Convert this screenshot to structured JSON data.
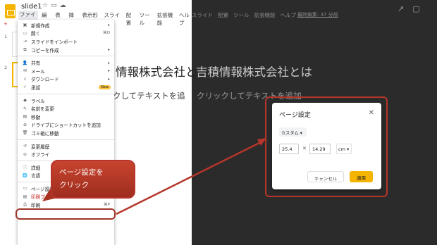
{
  "app": {
    "doc_title": "slide1",
    "menu": [
      "ファイル",
      "編集",
      "表示",
      "挿入",
      "表示形式",
      "スライド",
      "配置",
      "ツール",
      "拡張機能",
      "ヘルプ"
    ],
    "active_menu_index": 0,
    "filmstrip": [
      "1",
      "2"
    ],
    "last_edit": "最終編集: 37 分前"
  },
  "file_menu": {
    "items": [
      {
        "label": "新規作成",
        "icon": "new-icon",
        "arrow": "▸"
      },
      {
        "label": "開く",
        "icon": "open-icon",
        "shortcut": "⌘O"
      },
      {
        "label": "スライドをインポート",
        "icon": "import-icon"
      },
      {
        "label": "コピーを作成",
        "icon": "copy-icon",
        "arrow": "▸"
      },
      {
        "sep": true
      },
      {
        "label": "共有",
        "icon": "share-icon",
        "arrow": "▸"
      },
      {
        "label": "メール",
        "icon": "mail-icon",
        "arrow": "▸"
      },
      {
        "label": "ダウンロード",
        "icon": "download-icon",
        "arrow": "▸"
      },
      {
        "label": "承認",
        "icon": "approval-icon",
        "badge": "New"
      },
      {
        "sep": true
      },
      {
        "label": "ラベル",
        "icon": "label-icon"
      },
      {
        "label": "名前を変更",
        "icon": "rename-icon"
      },
      {
        "label": "移動",
        "icon": "move-icon"
      },
      {
        "label": "ドライブにショートカットを追加",
        "icon": "shortcut-icon"
      },
      {
        "label": "ゴミ箱に移動",
        "icon": "trash-icon"
      },
      {
        "sep": true
      },
      {
        "label": "変更履歴",
        "icon": "history-icon"
      },
      {
        "label": "オフライ",
        "icon": "offline-icon"
      },
      {
        "sep": true
      },
      {
        "label": "詳細",
        "icon": "info-icon"
      },
      {
        "label": "言語",
        "icon": "language-icon"
      },
      {
        "sep": true
      },
      {
        "label": "ページ設定",
        "icon": "page-setup-icon"
      },
      {
        "label": "印刷プレビュー",
        "icon": "print-preview-icon"
      },
      {
        "label": "印刷",
        "icon": "print-icon",
        "shortcut": "⌘P"
      }
    ]
  },
  "slide": {
    "title_left": "情報株式会社と",
    "title_right": "吉積情報株式会社とは",
    "subtitle_left": "クしてテキストを追",
    "subtitle_right": "クリックしてテキストを追加"
  },
  "dialog": {
    "title": "ページ設定",
    "close": "✕",
    "preset": "カスタム ▾",
    "width": "25.4",
    "times": "✕",
    "height": "14.29",
    "unit": "cm ▾",
    "cancel": "キャンセル",
    "apply": "適用"
  },
  "callout": {
    "text": "ページ設定を\nクリック"
  }
}
